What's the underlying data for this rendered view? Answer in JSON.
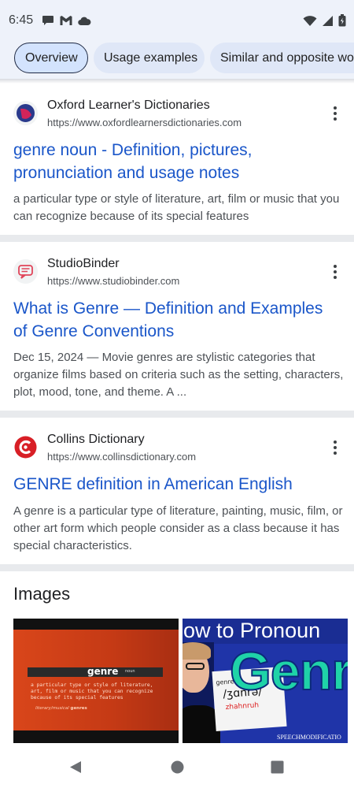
{
  "status_bar": {
    "time": "6:45",
    "left_icons": [
      "chat-icon",
      "gmail-icon",
      "cloud-icon"
    ],
    "right_icons": [
      "wifi-icon",
      "signal-icon",
      "battery-icon"
    ]
  },
  "chips": [
    {
      "label": "Overview",
      "active": true
    },
    {
      "label": "Usage examples",
      "active": false
    },
    {
      "label": "Similar and opposite wo",
      "active": false
    }
  ],
  "results": [
    {
      "source": "Oxford Learner's Dictionaries",
      "url": "https://www.oxfordlearnersdictionaries.com",
      "title": "genre noun - Definition, pictures, pronunciation and usage notes",
      "snippet": "a particular type or style of literature, art, film or music that you can recognize because of its special features"
    },
    {
      "source": "StudioBinder",
      "url": "https://www.studiobinder.com",
      "title": "What is Genre — Definition and Examples of Genre Conventions",
      "snippet": "Dec 15, 2024 — Movie genres are stylistic categories that organize films based on criteria such as the setting, characters, plot, mood, tone, and theme. A ..."
    },
    {
      "source": "Collins Dictionary",
      "url": "https://www.collinsdictionary.com",
      "title": "GENRE definition in American English",
      "snippet": "A genre is a particular type of literature, painting, music, film, or other art form which people consider as a class because it has special characteristics."
    }
  ],
  "images": {
    "heading": "Images",
    "thumb1": {
      "word": "genre",
      "pos": "noun",
      "definition_lines": [
        "a particular type or style of literature,",
        "art, film or music that you can recognize",
        "because of its special features"
      ],
      "example": "literary/musical genres",
      "example_prefix": "literary/musical ",
      "example_bold": "genres"
    },
    "thumb2": {
      "banner": "ow to Pronoun",
      "big_word": "Genr",
      "board_line1": "genre",
      "board_line2": "/ʒɑnrə/",
      "board_line3": "zhahnruh",
      "watermark": "SPEECHMODIFICATIO"
    }
  },
  "nav": [
    "back-icon",
    "home-icon",
    "recents-icon"
  ],
  "colors": {
    "link_blue": "#1a56c9",
    "header_bg": "#eef2fa",
    "chip_bg": "#dfe7f7",
    "divider": "#e8eaed"
  }
}
